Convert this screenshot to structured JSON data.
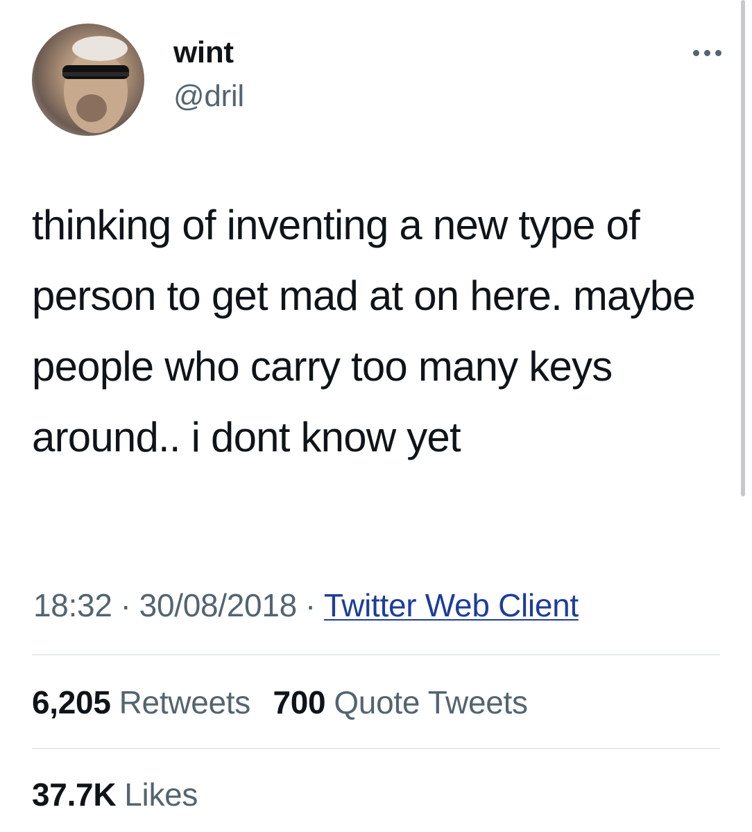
{
  "author": {
    "display_name": "wint",
    "handle": "@dril",
    "avatar_icon": "user-avatar-sunglasses"
  },
  "more_options_icon": "more-horizontal-icon",
  "tweet": {
    "text": "thinking of inventing a new type of person to get mad at on here. maybe people who carry too many keys around.. i dont know yet",
    "time": "18:32",
    "date": "30/08/2018",
    "separator": "·",
    "client": "Twitter Web Client"
  },
  "stats": {
    "retweets": {
      "count": "6,205",
      "label": "Retweets"
    },
    "quote_tweets": {
      "count": "700",
      "label": "Quote Tweets"
    },
    "likes": {
      "count": "37.7K",
      "label": "Likes"
    }
  },
  "colors": {
    "text_primary": "#0f1419",
    "text_secondary": "#536471",
    "link": "#1d3d9c",
    "divider": "#cfd9de"
  }
}
